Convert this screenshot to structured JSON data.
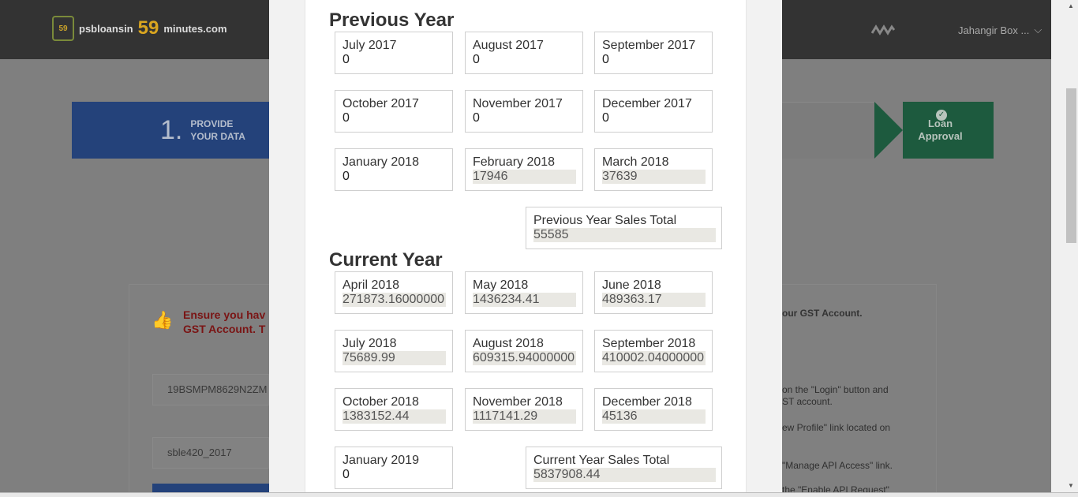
{
  "header": {
    "logo_badge": "59",
    "logo_prefix": "psbloansin",
    "logo_number": "59",
    "logo_suffix": "minutes.com",
    "user_name": "Jahangir Box ...",
    "user_chevron": "⌵"
  },
  "steps": {
    "step1_number": "1.",
    "step1_label_line1": "PROVIDE",
    "step1_label_line2": "YOUR DATA",
    "last_label_line1": "Loan",
    "last_label_line2": "Approval"
  },
  "background": {
    "ensure_line1": "Ensure you hav",
    "ensure_line2": "GST Account. T",
    "gst_note": "our GST Account.",
    "gstin_value": "19BSMPM8629N2ZM",
    "username_value": "sble420_2017",
    "instructions": [
      "on the \"Login\" button and",
      "ST account.",
      "ew Profile\" link located on",
      "\"Manage API Access\" link.",
      "the \"Enable API Request\""
    ]
  },
  "modal": {
    "previous_year_title": "Previous Year",
    "previous_year_months": [
      {
        "label": "July 2017",
        "value": "0",
        "filled": false
      },
      {
        "label": "August 2017",
        "value": "0",
        "filled": false
      },
      {
        "label": "September 2017",
        "value": "0",
        "filled": false
      },
      {
        "label": "October 2017",
        "value": "0",
        "filled": false
      },
      {
        "label": "November 2017",
        "value": "0",
        "filled": false
      },
      {
        "label": "December 2017",
        "value": "0",
        "filled": false
      },
      {
        "label": "January 2018",
        "value": "0",
        "filled": false
      },
      {
        "label": "February 2018",
        "value": "17946",
        "filled": true
      },
      {
        "label": "March 2018",
        "value": "37639",
        "filled": true
      }
    ],
    "previous_year_total_label": "Previous Year Sales Total",
    "previous_year_total_value": "55585",
    "current_year_title": "Current Year",
    "current_year_months": [
      {
        "label": "April 2018",
        "value": "271873.16000000",
        "filled": true
      },
      {
        "label": "May 2018",
        "value": "1436234.41",
        "filled": true
      },
      {
        "label": "June 2018",
        "value": "489363.17",
        "filled": true
      },
      {
        "label": "July 2018",
        "value": "75689.99",
        "filled": true
      },
      {
        "label": "August 2018",
        "value": "609315.94000000",
        "filled": true
      },
      {
        "label": "September 2018",
        "value": "410002.04000000",
        "filled": true
      },
      {
        "label": "October 2018",
        "value": "1383152.44",
        "filled": true
      },
      {
        "label": "November 2018",
        "value": "1117141.29",
        "filled": true
      },
      {
        "label": "December 2018",
        "value": "45136",
        "filled": true
      },
      {
        "label": "January 2019",
        "value": "0",
        "filled": false
      }
    ],
    "current_year_total_label": "Current Year Sales Total",
    "current_year_total_value": "5837908.44"
  }
}
